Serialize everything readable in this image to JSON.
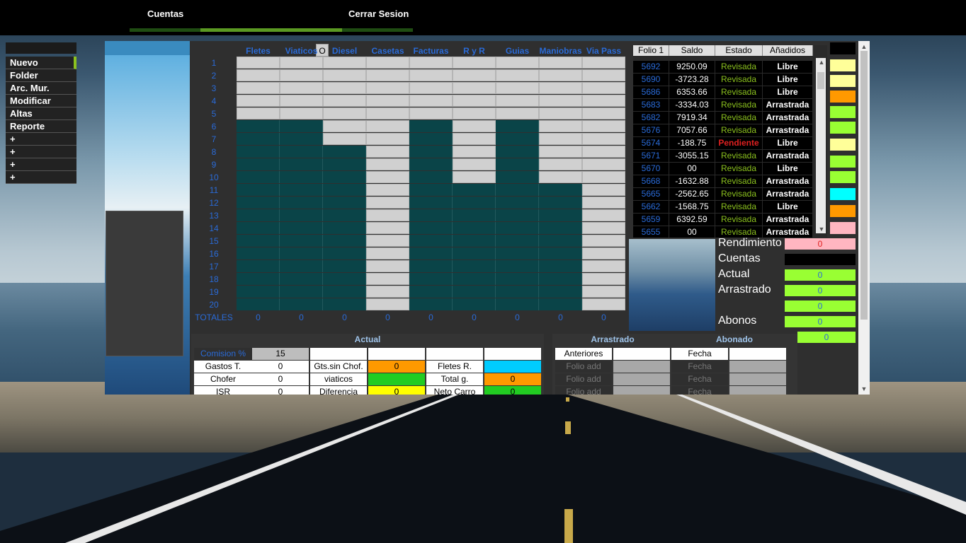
{
  "nav": {
    "items": [
      {
        "label": "Cuentas"
      },
      {
        "label": "Cerrar Sesion"
      }
    ]
  },
  "menu": {
    "items": [
      "Nuevo",
      "Folder",
      "Arc. Mur.",
      "Modificar",
      "Altas",
      "Reporte",
      "+",
      "+",
      "+",
      "+"
    ],
    "active": "Nuevo"
  },
  "grid": {
    "corner_button": "O",
    "columns": [
      "Fletes",
      "Viaticos",
      "Diesel",
      "Casetas",
      "Facturas",
      "R y R",
      "Guias",
      "Maniobras",
      "Via Pass"
    ],
    "rows": [
      "1",
      "2",
      "3",
      "4",
      "5",
      "6",
      "7",
      "8",
      "9",
      "10",
      "11",
      "12",
      "13",
      "14",
      "15",
      "16",
      "17",
      "18",
      "19",
      "20"
    ],
    "filled_rows_per_column": [
      5,
      5,
      7,
      20,
      5,
      10,
      5,
      10,
      20
    ],
    "totals_label": "TOTALES",
    "totals": [
      "0",
      "0",
      "0",
      "0",
      "0",
      "0",
      "0",
      "0",
      "0"
    ]
  },
  "folios": {
    "headers": [
      "Folio 1",
      "Saldo",
      "Estado",
      "Añadidos"
    ],
    "rows": [
      {
        "folio": "5692",
        "saldo": "9250.09",
        "estado": "Revisada",
        "anadidos": "Libre"
      },
      {
        "folio": "5690",
        "saldo": "-3723.28",
        "estado": "Revisada",
        "anadidos": "Libre"
      },
      {
        "folio": "5686",
        "saldo": "6353.66",
        "estado": "Revisada",
        "anadidos": "Libre"
      },
      {
        "folio": "5683",
        "saldo": "-3334.03",
        "estado": "Revisada",
        "anadidos": "Arrastrada"
      },
      {
        "folio": "5682",
        "saldo": "7919.34",
        "estado": "Revisada",
        "anadidos": "Arrastrada"
      },
      {
        "folio": "5676",
        "saldo": "7057.66",
        "estado": "Revisada",
        "anadidos": "Arrastrada"
      },
      {
        "folio": "5674",
        "saldo": "-188.75",
        "estado": "Pendiente",
        "anadidos": "Libre"
      },
      {
        "folio": "5671",
        "saldo": "-3055.15",
        "estado": "Revisada",
        "anadidos": "Arrastrada"
      },
      {
        "folio": "5670",
        "saldo": "00",
        "estado": "Revisada",
        "anadidos": "Libre"
      },
      {
        "folio": "5668",
        "saldo": "-1632.88",
        "estado": "Revisada",
        "anadidos": "Arrastrada"
      },
      {
        "folio": "5665",
        "saldo": "-2562.65",
        "estado": "Revisada",
        "anadidos": "Arrastrada"
      },
      {
        "folio": "5662",
        "saldo": "-1568.75",
        "estado": "Revisada",
        "anadidos": "Libre"
      },
      {
        "folio": "5659",
        "saldo": "6392.59",
        "estado": "Revisada",
        "anadidos": "Arrastrada"
      },
      {
        "folio": "5655",
        "saldo": "00",
        "estado": "Revisada",
        "anadidos": "Arrastrada"
      }
    ],
    "estado_colors": {
      "Revisada": "#8bc11e",
      "Pendiente": "#e02020"
    }
  },
  "swatch_colors": [
    "#000000",
    "#ffff99",
    "#ffff99",
    "#ff9900",
    "#99ff33",
    "#99ff33",
    "#ffff99",
    "#99ff33",
    "#99ff33",
    "#00ffff",
    "#ff9900",
    "#ffb6c1"
  ],
  "info": {
    "rendimiento_label": "Rendimiento",
    "rendimiento_value": "0",
    "cuentas_label": "Cuentas",
    "actual_label": "Actual",
    "actual_value": "0",
    "arrastrado_label": "Arrastrado",
    "arrastrado_value": "0",
    "extra_value": "0",
    "abonos_label": "Abonos",
    "abonos_value": "0",
    "last_value": "0"
  },
  "actual_table": {
    "title": "Actual",
    "comision_label": "Comision %",
    "comision_value": "15",
    "rows": [
      {
        "l1": "Gastos T.",
        "v1": "0",
        "l2": "Gts.sin Chof.",
        "v2": "0",
        "l3": "Fletes R.",
        "v3": ""
      },
      {
        "l1": "Chofer",
        "v1": "0",
        "l2": "viaticos",
        "v2": "",
        "l3": "Total g.",
        "v3": "0"
      },
      {
        "l1": "ISR",
        "v1": "0",
        "l2": "Diferencia",
        "v2": "0",
        "l3": "Neto Carro",
        "v3": "0"
      }
    ]
  },
  "arrastrado_table": {
    "title_left": "Arrastrado",
    "title_right": "Abonado",
    "header": {
      "c1": "Anteriores",
      "c3": "Fecha"
    },
    "rows": [
      {
        "c1": "Folio add",
        "c3": "Fecha"
      },
      {
        "c1": "Folio add",
        "c3": "Fecha"
      },
      {
        "c1": "Folio add",
        "c3": "Fecha"
      }
    ]
  }
}
